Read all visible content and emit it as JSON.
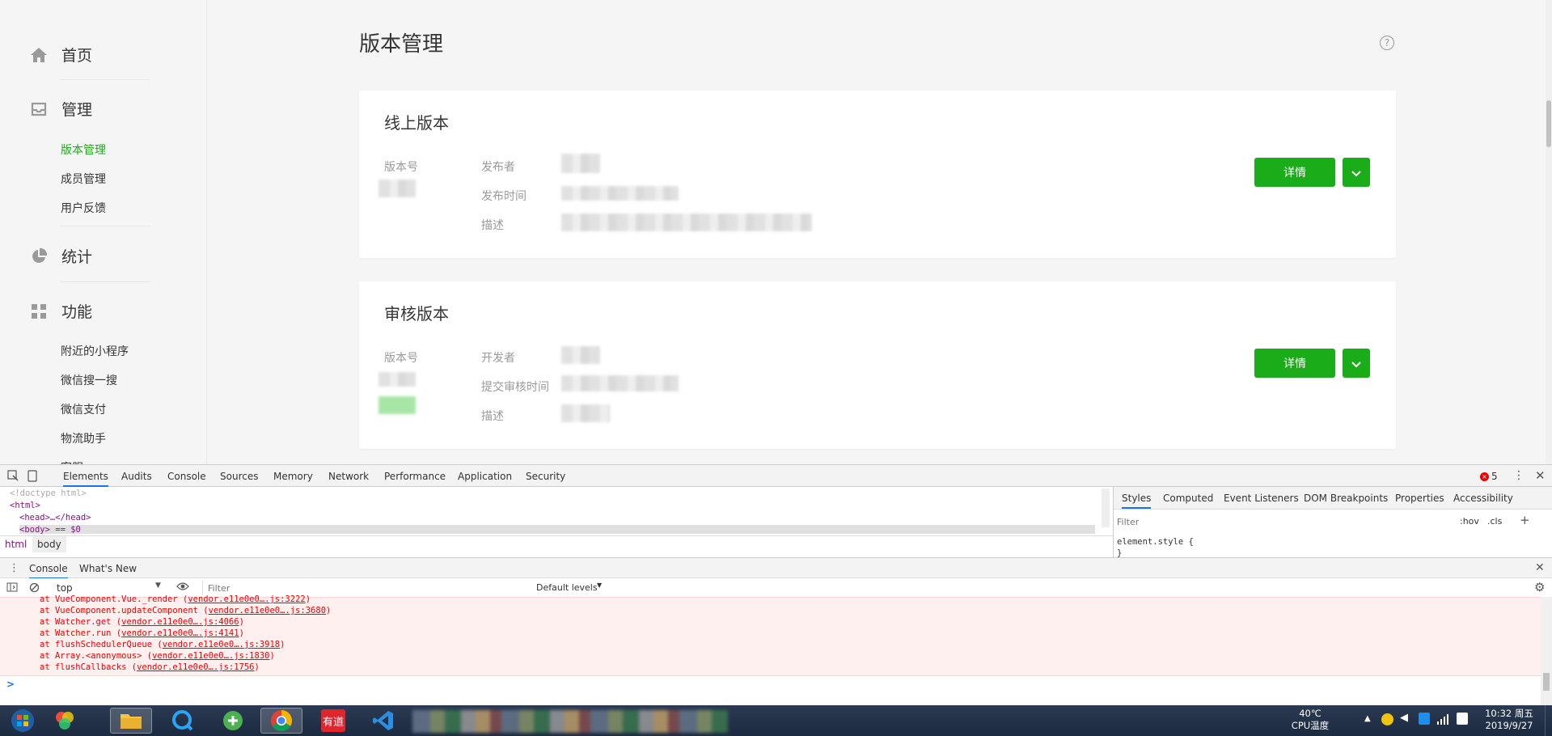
{
  "sidebar": {
    "home": "首页",
    "manage": "管理",
    "manage_items": [
      "版本管理",
      "成员管理",
      "用户反馈"
    ],
    "stats": "统计",
    "features": "功能",
    "feature_items": [
      "附近的小程序",
      "微信搜一搜",
      "微信支付",
      "物流助手",
      "客服"
    ]
  },
  "main": {
    "title": "版本管理",
    "help": "?",
    "online": {
      "title": "线上版本",
      "version_label": "版本号",
      "publisher_label": "发布者",
      "time_label": "发布时间",
      "desc_label": "描述",
      "detail_button": "详情"
    },
    "review": {
      "title": "审核版本",
      "version_label": "版本号",
      "developer_label": "开发者",
      "time_label": "提交审核时间",
      "desc_label": "描述",
      "detail_button": "详情"
    }
  },
  "devtools": {
    "tabs": [
      "Elements",
      "Audits",
      "Console",
      "Sources",
      "Memory",
      "Network",
      "Performance",
      "Application",
      "Security"
    ],
    "error_count": "5",
    "dom_lines": [
      "<!doctype html>",
      "<html>",
      "<head>…</head>",
      "<body> == $0"
    ],
    "breadcrumbs": [
      "html",
      "body"
    ],
    "styles_tabs": [
      "Styles",
      "Computed",
      "Event Listeners",
      "DOM Breakpoints",
      "Properties",
      "Accessibility"
    ],
    "styles_filter_placeholder": "Filter",
    "hov": ":hov",
    "cls": ".cls",
    "element_style": "element.style {",
    "element_style_close": "}",
    "drawer_tabs": [
      "Console",
      "What's New"
    ],
    "context": "top",
    "console_filter_placeholder": "Filter",
    "levels": "Default levels",
    "console_lines": [
      {
        "text": "at VueComponent.Vue._render (",
        "link": "vendor.e11e0e0….js:3222",
        "end": ")"
      },
      {
        "text": "at VueComponent.updateComponent (",
        "link": "vendor.e11e0e0….js:3680",
        "end": ")"
      },
      {
        "text": "at Watcher.get (",
        "link": "vendor.e11e0e0….js:4066",
        "end": ")"
      },
      {
        "text": "at Watcher.run (",
        "link": "vendor.e11e0e0….js:4141",
        "end": ")"
      },
      {
        "text": "at flushSchedulerQueue (",
        "link": "vendor.e11e0e0….js:3918",
        "end": ")"
      },
      {
        "text": "at Array.<anonymous> (",
        "link": "vendor.e11e0e0….js:1830",
        "end": ")"
      },
      {
        "text": "at flushCallbacks (",
        "link": "vendor.e11e0e0….js:1756",
        "end": ")"
      }
    ],
    "prompt": ">"
  },
  "taskbar": {
    "youdao_label": "有道",
    "temp": "40℃",
    "cpu": "CPU温度",
    "time": "10:32 周五",
    "date": "2019/9/27"
  },
  "colors": {
    "accent_green": "#1aad19",
    "devtools_blue": "#1a73e8",
    "error_red": "#e00"
  }
}
